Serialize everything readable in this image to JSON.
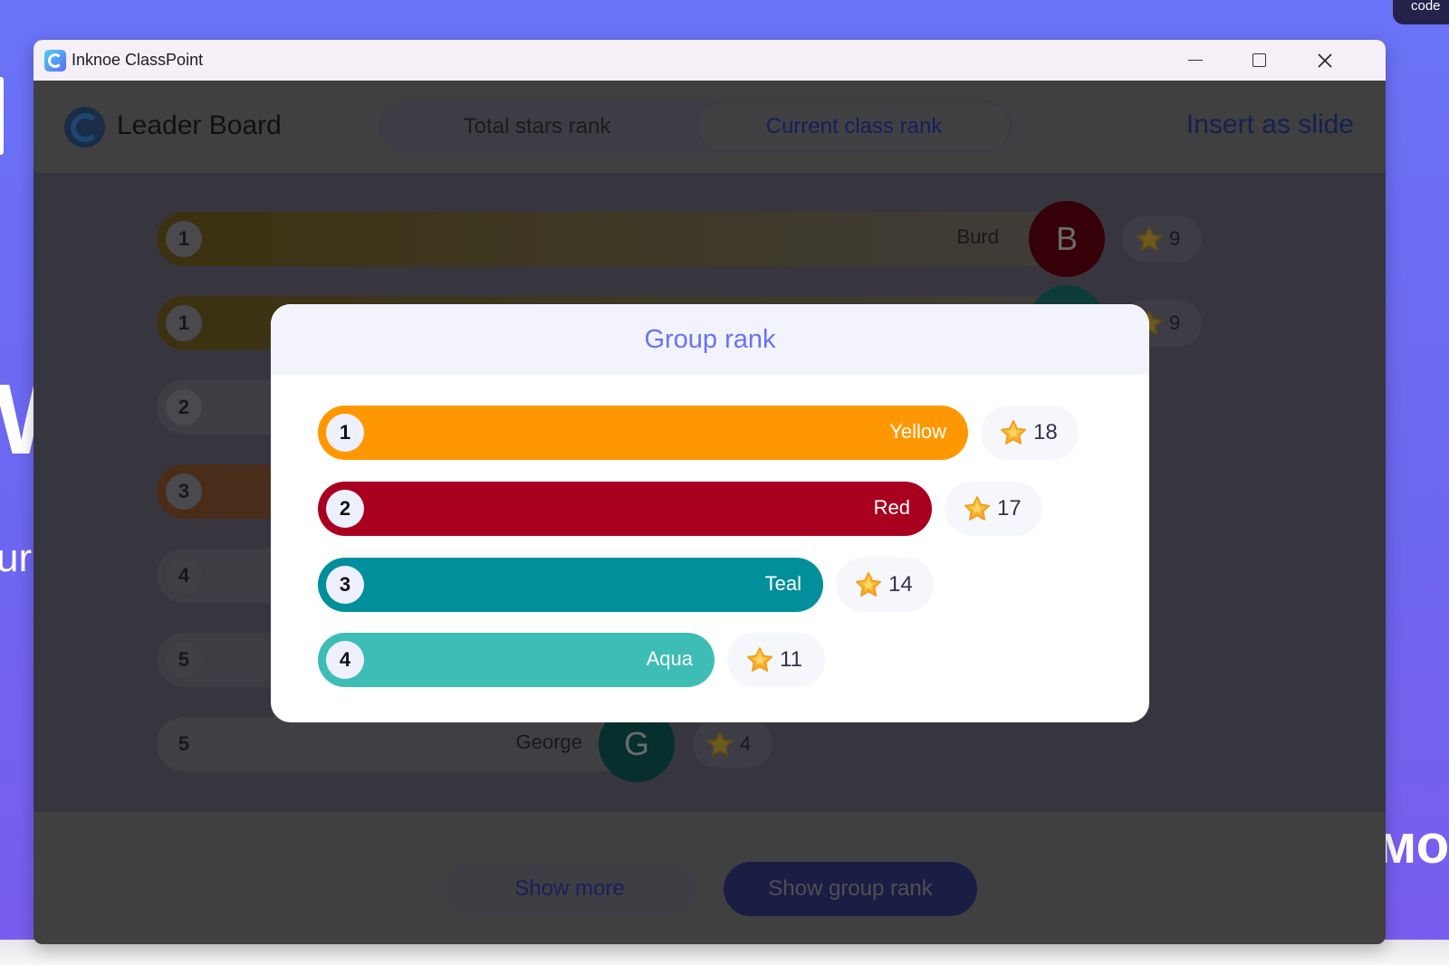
{
  "desktop": {
    "badge_text": "code",
    "bg_text_left": "W",
    "bg_text_left2": "ur",
    "bg_text_right": "мо"
  },
  "window": {
    "title": "Inknoe ClassPoint",
    "controls": {
      "minimize": "minimize",
      "maximize": "maximize",
      "close": "close"
    }
  },
  "header": {
    "title": "Leader Board",
    "tabs": [
      {
        "label": "Total stars rank",
        "active": false
      },
      {
        "label": "Current class rank",
        "active": true
      }
    ],
    "insert_label": "Insert as slide"
  },
  "leaderboard": {
    "rows": [
      {
        "rank": "1",
        "name": "Burd",
        "initial": "B",
        "stars": "9",
        "avatar_color": "#350008"
      },
      {
        "rank": "1",
        "name": "",
        "initial": "",
        "stars": "9",
        "avatar_color": "#0d3c38"
      },
      {
        "rank": "2",
        "name": "",
        "initial": "",
        "stars": "",
        "avatar_color": ""
      },
      {
        "rank": "3",
        "name": "",
        "initial": "",
        "stars": "",
        "avatar_color": ""
      },
      {
        "rank": "4",
        "name": "",
        "initial": "",
        "stars": "",
        "avatar_color": ""
      },
      {
        "rank": "5",
        "name": "",
        "initial": "",
        "stars": "",
        "avatar_color": ""
      },
      {
        "rank": "5",
        "name": "George",
        "initial": "G",
        "stars": "4",
        "avatar_color": "#062f2e"
      }
    ]
  },
  "footer": {
    "show_more": "Show more",
    "show_group_rank": "Show group rank"
  },
  "modal": {
    "title": "Group rank",
    "groups": [
      {
        "rank": "1",
        "name": "Yellow",
        "stars": "18",
        "color": "#ff9800"
      },
      {
        "rank": "2",
        "name": "Red",
        "stars": "17",
        "color": "#a90020"
      },
      {
        "rank": "3",
        "name": "Teal",
        "stars": "14",
        "color": "#028f9c"
      },
      {
        "rank": "4",
        "name": "Aqua",
        "stars": "11",
        "color": "#3dbdb5"
      }
    ]
  },
  "colors": {
    "accent": "#6873f0",
    "primary_dark": "#1a1d44"
  }
}
